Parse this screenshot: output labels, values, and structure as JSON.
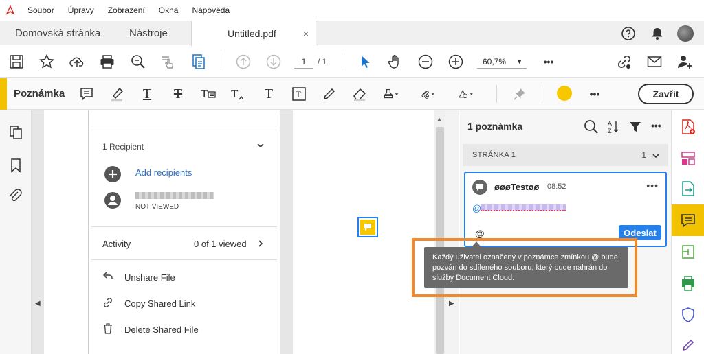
{
  "menu": [
    "Soubor",
    "Úpravy",
    "Zobrazení",
    "Okna",
    "Nápověda"
  ],
  "tabs": {
    "home": "Domovská stránka",
    "tools": "Nástroje",
    "document": "Untitled.pdf",
    "close_symbol": "×"
  },
  "toolbar": {
    "page_current": "1",
    "page_total": "/ 1",
    "zoom": "60,7%",
    "more": "•••"
  },
  "comment_toolbar": {
    "title": "Poznámka",
    "close_label": "Zavřít",
    "more": "•••"
  },
  "share_panel": {
    "recipients_header": "1 Recipient",
    "add_recipients": "Add recipients",
    "recipient_status": "NOT VIEWED",
    "activity_label": "Activity",
    "activity_value": "0 of 1 viewed",
    "unshare": "Unshare File",
    "copy_link": "Copy Shared Link",
    "delete": "Delete Shared File"
  },
  "comments_panel": {
    "header": "1 poznámka",
    "page_label": "STRÁNKA 1",
    "page_count": "1",
    "comment": {
      "author": "øøøTestøø",
      "time": "08:52",
      "mention_prefix": "@",
      "reply_at": "@",
      "send_label": "Odeslat",
      "more": "•••"
    }
  },
  "tooltip": {
    "text": "Každý uživatel označený v poznámce zmínkou @ bude pozván do sdíleného souboru, který bude nahrán do služby Document Cloud."
  },
  "colors": {
    "accent_blue": "#2680eb",
    "highlight_yellow": "#f2c200",
    "callout_orange": "#f08a2a",
    "tooltip_gray": "#6a6a6a"
  }
}
